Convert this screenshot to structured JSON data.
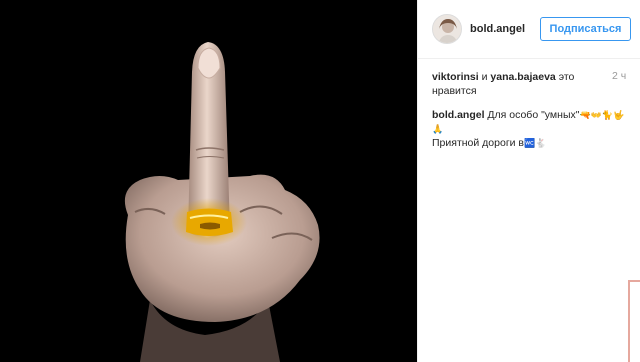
{
  "post": {
    "username": "bold.angel",
    "follow_label": "Подписаться",
    "likes_user1": "viktorinsi",
    "likes_and": " и ",
    "likes_user2": "yana.bajaeva",
    "likes_suffix": " это нравится",
    "time": "2 ч",
    "caption_user": "bold.angel",
    "caption_text_1": " Для особо \"умных\"",
    "caption_emoji_1": "🔫👐🐈🤟🙏",
    "caption_text_2": "Приятной дороги в",
    "caption_emoji_2": "🚾🐇"
  },
  "colors": {
    "accent": "#3897f0",
    "photo_bg": "#000000",
    "ring": "#e8a800"
  },
  "icons": {
    "avatar": "avatar"
  }
}
